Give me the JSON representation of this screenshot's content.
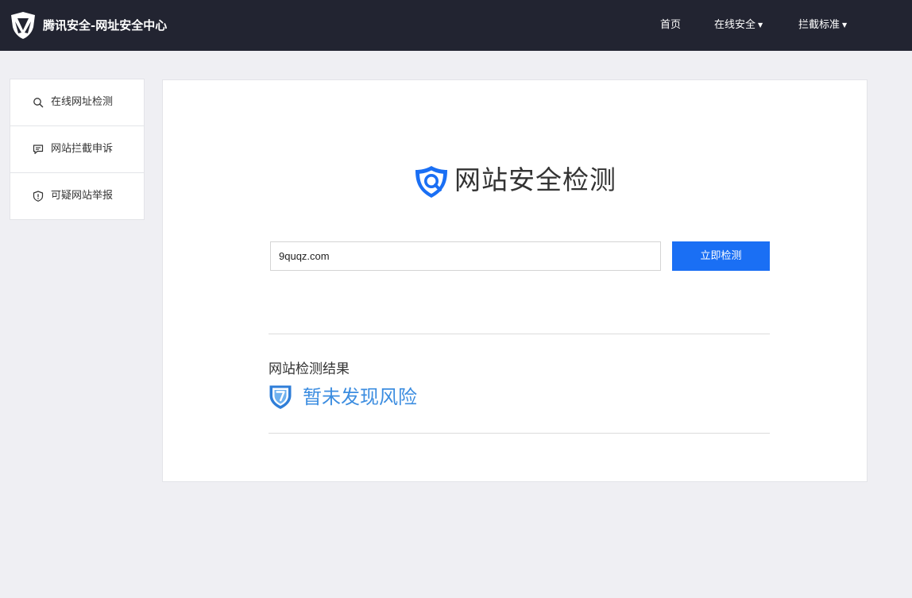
{
  "header": {
    "brand": "腾讯安全-网址安全中心",
    "nav": [
      {
        "label": "首页",
        "has_caret": false
      },
      {
        "label": "在线安全",
        "has_caret": true
      },
      {
        "label": "拦截标准",
        "has_caret": true
      }
    ],
    "caret_glyph": "▼"
  },
  "sidebar": {
    "items": [
      {
        "label": "在线网址检测",
        "icon": "search-icon"
      },
      {
        "label": "网站拦截申诉",
        "icon": "message-icon"
      },
      {
        "label": "可疑网站举报",
        "icon": "shield-alert-icon"
      }
    ]
  },
  "main": {
    "title": "网站安全检测",
    "search": {
      "value": "9quqz.com",
      "placeholder": ""
    },
    "check_button": "立即检测",
    "result": {
      "label": "网站检测结果",
      "status": "暂未发现风险",
      "icon": "shield-check-icon"
    }
  },
  "colors": {
    "topbar": "#222431",
    "page_bg": "#efeff3",
    "accent": "#1a6ff4",
    "result_text": "#3c8de0"
  }
}
